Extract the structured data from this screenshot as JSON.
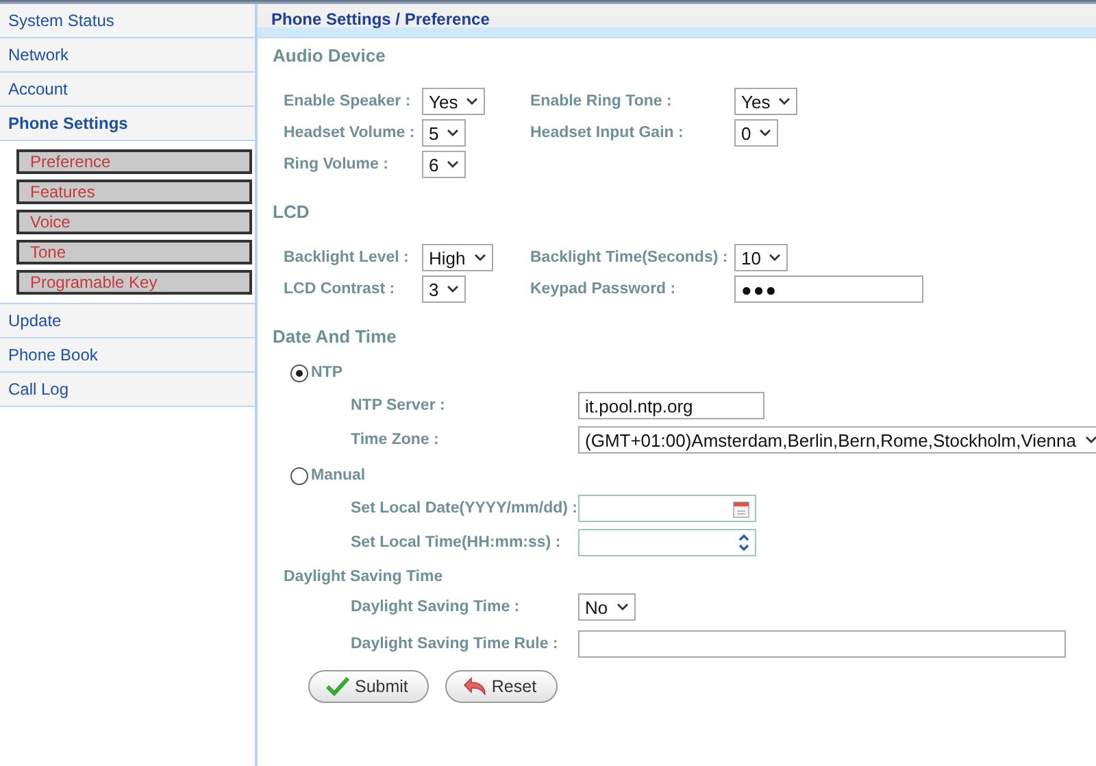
{
  "sidebar": {
    "items": [
      {
        "label": "System Status",
        "selected": false
      },
      {
        "label": "Network",
        "selected": false
      },
      {
        "label": "Account",
        "selected": false
      },
      {
        "label": "Phone Settings",
        "selected": true,
        "children": [
          {
            "label": "Preference"
          },
          {
            "label": "Features"
          },
          {
            "label": "Voice"
          },
          {
            "label": "Tone"
          },
          {
            "label": "Programable Key"
          }
        ]
      },
      {
        "label": "Update",
        "selected": false
      },
      {
        "label": "Phone Book",
        "selected": false
      },
      {
        "label": "Call Log",
        "selected": false
      }
    ]
  },
  "header": {
    "title": "Phone Settings / Preference"
  },
  "audio_device": {
    "title": "Audio Device",
    "fields": [
      {
        "label": "Enable Speaker :",
        "kind": "select",
        "value": "Yes"
      },
      {
        "label": "Enable Ring Tone :",
        "kind": "select",
        "value": "Yes"
      },
      {
        "label": "Headset Volume :",
        "kind": "select",
        "value": "5"
      },
      {
        "label": "Headset Input Gain :",
        "kind": "select",
        "value": "0"
      },
      {
        "label": "Ring Volume :",
        "kind": "select",
        "value": "6"
      }
    ]
  },
  "lcd": {
    "title": "LCD",
    "fields": [
      {
        "label": "Backlight Level :",
        "kind": "select",
        "value": "High"
      },
      {
        "label": "Backlight Time(Seconds) :",
        "kind": "select",
        "value": "10"
      },
      {
        "label": "LCD Contrast :",
        "kind": "select",
        "value": "3"
      },
      {
        "label": "Keypad Password :",
        "kind": "password",
        "value": "●●●"
      }
    ]
  },
  "date_and_time": {
    "title": "Date And Time",
    "modes": [
      {
        "label": "NTP",
        "selected": true,
        "fields": [
          {
            "label": "NTP Server :",
            "kind": "text",
            "value": "it.pool.ntp.org"
          },
          {
            "label": "Time Zone :",
            "kind": "select",
            "value": "(GMT+01:00)Amsterdam,Berlin,Bern,Rome,Stockholm,Vienna"
          }
        ]
      },
      {
        "label": "Manual",
        "selected": false,
        "fields": [
          {
            "label": "Set Local Date(YYYY/mm/dd) :",
            "kind": "date"
          },
          {
            "label": "Set Local Time(HH:mm:ss) :",
            "kind": "time"
          }
        ]
      }
    ],
    "daylight_saving": {
      "title": "Daylight Saving Time",
      "fields": [
        {
          "label": "Daylight Saving Time :",
          "kind": "select",
          "value": "No"
        },
        {
          "label": "Daylight Saving Time Rule :",
          "kind": "wide_text"
        }
      ]
    }
  },
  "buttons": [
    {
      "label": "Submit",
      "kind": "submit"
    },
    {
      "label": "Reset",
      "kind": "reset"
    }
  ]
}
